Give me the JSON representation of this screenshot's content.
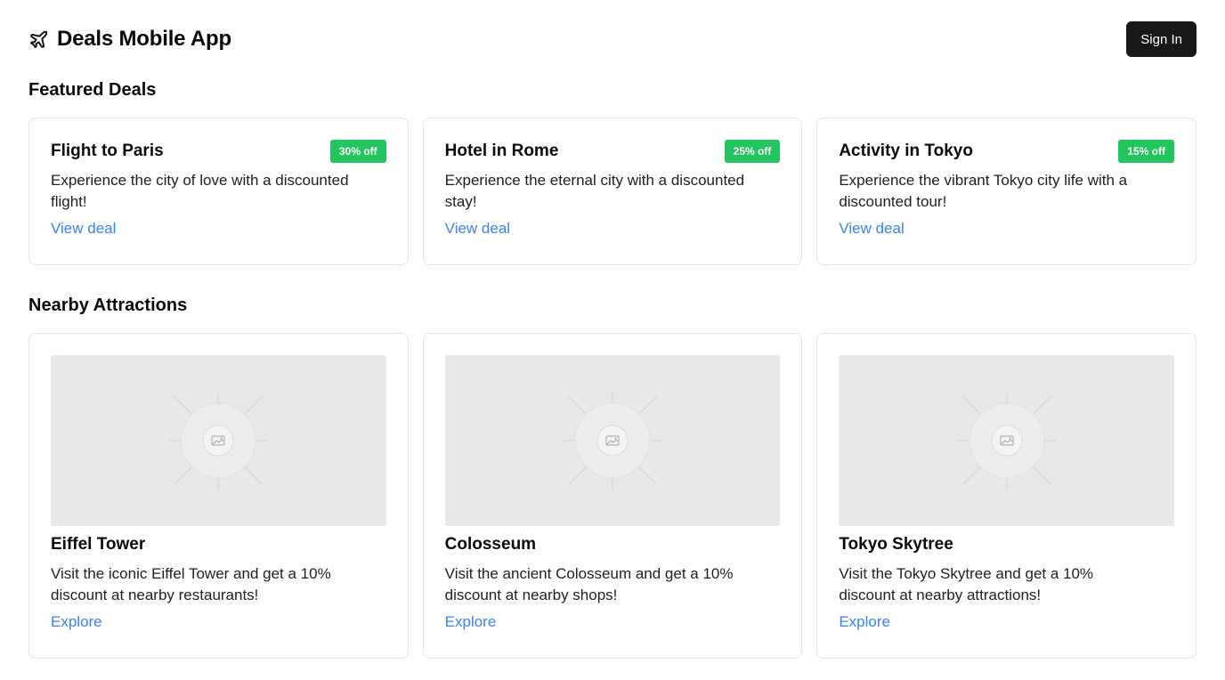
{
  "header": {
    "title": "Deals Mobile App",
    "logo_icon": "plane-icon",
    "signin_label": "Sign In"
  },
  "featured": {
    "title": "Featured Deals",
    "deals": [
      {
        "title": "Flight to Paris",
        "badge": "30% off",
        "description": "Experience the city of love with a discounted flight!",
        "link": "View deal"
      },
      {
        "title": "Hotel in Rome",
        "badge": "25% off",
        "description": "Experience the eternal city with a discounted stay!",
        "link": "View deal"
      },
      {
        "title": "Activity in Tokyo",
        "badge": "15% off",
        "description": "Experience the vibrant Tokyo city life with a discounted tour!",
        "link": "View deal"
      }
    ]
  },
  "nearby": {
    "title": "Nearby Attractions",
    "attractions": [
      {
        "title": "Eiffel Tower",
        "description": "Visit the iconic Eiffel Tower and get a 10% discount at nearby restaurants!",
        "link": "Explore",
        "image_icon": "image-placeholder-icon"
      },
      {
        "title": "Colosseum",
        "description": "Visit the ancient Colosseum and get a 10% discount at nearby shops!",
        "link": "Explore",
        "image_icon": "image-placeholder-icon"
      },
      {
        "title": "Tokyo Skytree",
        "description": "Visit the Tokyo Skytree and get a 10% discount at nearby attractions!",
        "link": "Explore",
        "image_icon": "image-placeholder-icon"
      }
    ]
  },
  "colors": {
    "badge": "#22c55e",
    "link": "#3b82f6",
    "button": "#18181b"
  }
}
